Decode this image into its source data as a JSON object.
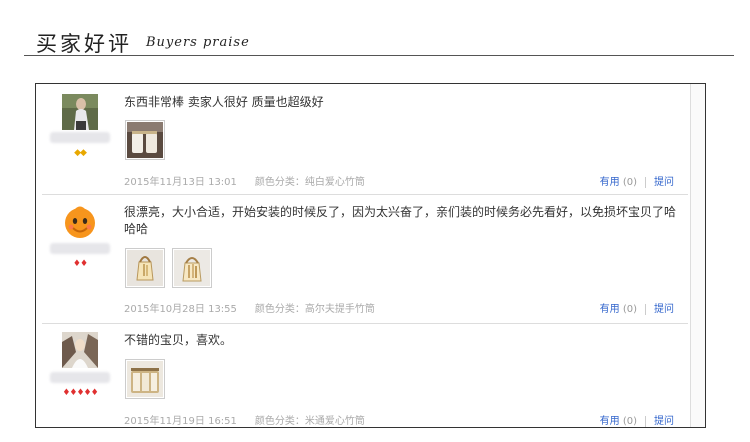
{
  "header": {
    "title_cn": "买家好评",
    "title_en": "Buyers praise"
  },
  "reviews": [
    {
      "text": "东西非常棒 卖家人很好 质量也超级好",
      "date": "2015年11月13日 13:01",
      "sku": "颜色分类：纯白爱心竹筒",
      "rank": "◆◆",
      "helpful_label": "有用",
      "helpful_count": "(0)",
      "ask_label": "提问"
    },
    {
      "text": "很漂亮，大小合适，开始安装的时候反了，因为太兴奋了，亲们装的时候务必先看好，以免损坏宝贝了哈哈哈",
      "date": "2015年10月28日 13:55",
      "sku": "颜色分类：高尔夫提手竹筒",
      "rank": "♦♦",
      "helpful_label": "有用",
      "helpful_count": "(0)",
      "ask_label": "提问"
    },
    {
      "text": "不错的宝贝，喜欢。",
      "date": "2015年11月19日 16:51",
      "sku": "颜色分类：米通爱心竹筒",
      "rank": "♦♦♦♦♦",
      "helpful_label": "有用",
      "helpful_count": "(0)",
      "ask_label": "提问"
    }
  ]
}
